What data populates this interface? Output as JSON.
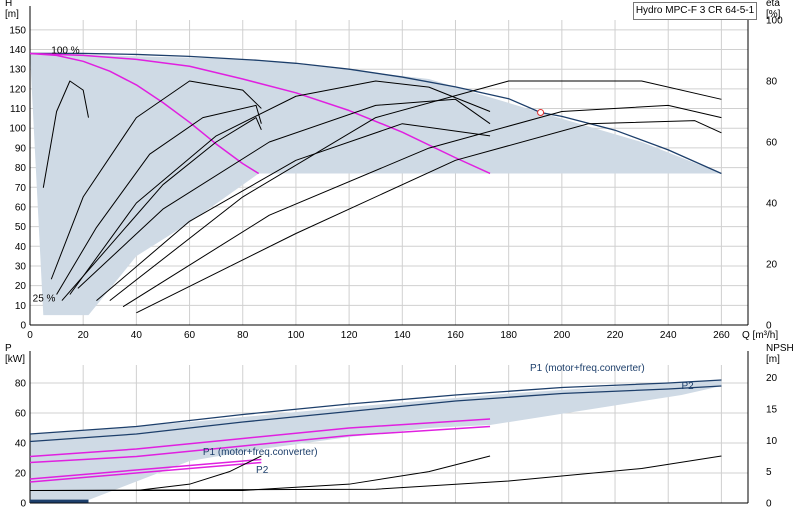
{
  "title": "Hydro MPC-F 3 CR 64-5-1",
  "colors": {
    "envelope": "#cfdae5",
    "max_curve": "#1d3f6b",
    "speed_curve": "#e020e0",
    "eff_curve": "#000000",
    "grid": "#d0d0d0"
  },
  "chart_data": [
    {
      "type": "line",
      "name": "head-efficiency",
      "xlabel": "Q [m³/h]",
      "ylabel": "H",
      "ylabel_unit": "[m]",
      "y2label": "eta",
      "y2label_unit": "[%]",
      "xlim": [
        0,
        270
      ],
      "ylim": [
        0,
        155
      ],
      "y2lim": [
        0,
        100
      ],
      "xticks": [
        0,
        20,
        40,
        60,
        80,
        100,
        120,
        140,
        160,
        180,
        200,
        220,
        240,
        260
      ],
      "yticks": [
        0,
        10,
        20,
        30,
        40,
        50,
        60,
        70,
        80,
        90,
        100,
        110,
        120,
        130,
        140,
        150
      ],
      "y2ticks": [
        0,
        20,
        40,
        60,
        80,
        100
      ],
      "grid": true,
      "annotations": [
        "100 %",
        "25 %"
      ],
      "duty_point": {
        "x": 192,
        "y": 108
      },
      "envelope": [
        [
          0,
          138
        ],
        [
          85,
          135
        ],
        [
          150,
          125
        ],
        [
          192,
          108
        ],
        [
          230,
          93
        ],
        [
          260,
          77
        ],
        [
          260,
          77
        ],
        [
          86,
          77
        ],
        [
          60,
          52
        ],
        [
          40,
          35
        ],
        [
          22,
          5
        ],
        [
          5,
          5
        ],
        [
          0,
          138
        ]
      ],
      "series": [
        {
          "role": "max",
          "x": [
            0,
            20,
            40,
            60,
            86,
            100,
            120,
            140,
            160,
            180,
            192,
            200,
            220,
            240,
            260
          ],
          "y": [
            138,
            138,
            137.5,
            136.5,
            134.5,
            133,
            130,
            126,
            121,
            115,
            108,
            106,
            99,
            89,
            77
          ]
        },
        {
          "role": "speed",
          "x": [
            0,
            20,
            40,
            60,
            80,
            100,
            120,
            140,
            160,
            173
          ],
          "y": [
            138,
            137,
            135,
            131.5,
            125,
            118,
            109,
            98,
            85,
            77
          ]
        },
        {
          "role": "speed",
          "x": [
            0,
            10,
            20,
            30,
            40,
            50,
            60,
            70,
            80,
            86
          ],
          "y": [
            138,
            137,
            134,
            129,
            122,
            113,
            103,
            92,
            82,
            77
          ]
        },
        {
          "role": "eff",
          "x": [
            8,
            20,
            40,
            60,
            80,
            87
          ],
          "y2": [
            15,
            42,
            68,
            80,
            77,
            71
          ]
        },
        {
          "role": "eff",
          "x": [
            10,
            25,
            45,
            65,
            85,
            87
          ],
          "y2": [
            10,
            32,
            56,
            68,
            72,
            66
          ]
        },
        {
          "role": "eff",
          "x": [
            12,
            30,
            50,
            70,
            85,
            87
          ],
          "y2": [
            8,
            26,
            46,
            60,
            68,
            64
          ]
        },
        {
          "role": "eff",
          "x": [
            15,
            40,
            70,
            100,
            130,
            150,
            173
          ],
          "y2": [
            10,
            40,
            62,
            75,
            80,
            78,
            70
          ]
        },
        {
          "role": "eff",
          "x": [
            18,
            50,
            90,
            130,
            160,
            173
          ],
          "y2": [
            12,
            38,
            60,
            72,
            74,
            66
          ]
        },
        {
          "role": "eff",
          "x": [
            25,
            60,
            100,
            140,
            173
          ],
          "y2": [
            8,
            34,
            54,
            66,
            62
          ]
        },
        {
          "role": "eff",
          "x": [
            30,
            80,
            130,
            180,
            230,
            260
          ],
          "y2": [
            8,
            42,
            68,
            80,
            80,
            74
          ]
        },
        {
          "role": "eff",
          "x": [
            35,
            90,
            150,
            200,
            240,
            260
          ],
          "y2": [
            6,
            36,
            58,
            70,
            72,
            68
          ]
        },
        {
          "role": "eff",
          "x": [
            40,
            100,
            160,
            210,
            250,
            260
          ],
          "y2": [
            4,
            30,
            54,
            66,
            67,
            63
          ]
        },
        {
          "role": "eff",
          "x": [
            5,
            10,
            15,
            20,
            22
          ],
          "y2": [
            45,
            70,
            80,
            77,
            68
          ]
        }
      ]
    },
    {
      "type": "line",
      "name": "power-npsh",
      "xlabel": "",
      "ylabel": "P",
      "ylabel_unit": "[kW]",
      "y2label": "NPSH",
      "y2label_unit": "[m]",
      "xlim": [
        0,
        270
      ],
      "ylim": [
        0,
        92
      ],
      "y2lim": [
        0,
        22
      ],
      "yticks": [
        0,
        20,
        40,
        60,
        80
      ],
      "y2ticks": [
        0,
        5,
        10,
        15,
        20
      ],
      "grid": true,
      "labels": [
        {
          "text": "P1 (motor+freq.converter)",
          "x": 188,
          "y": 88
        },
        {
          "text": "P2",
          "x": 245,
          "y": 76
        },
        {
          "text": "P1 (motor+freq.converter)",
          "x": 65,
          "y": 32
        },
        {
          "text": "P2",
          "x": 85,
          "y": 20
        }
      ],
      "envelope": [
        [
          0,
          46
        ],
        [
          60,
          54
        ],
        [
          120,
          64
        ],
        [
          180,
          73
        ],
        [
          230,
          79
        ],
        [
          260,
          82
        ],
        [
          260,
          78
        ],
        [
          245,
          72
        ],
        [
          173,
          52
        ],
        [
          150,
          50
        ],
        [
          120,
          44
        ],
        [
          87,
          36
        ],
        [
          60,
          28
        ],
        [
          22,
          2
        ],
        [
          0,
          2
        ]
      ],
      "series": [
        {
          "role": "max",
          "x": [
            0,
            40,
            80,
            120,
            160,
            200,
            240,
            260
          ],
          "y": [
            46,
            51,
            59,
            66,
            72,
            77,
            80,
            82
          ]
        },
        {
          "role": "max",
          "x": [
            0,
            40,
            80,
            120,
            160,
            200,
            240,
            260
          ],
          "y": [
            41,
            46,
            54,
            61,
            68,
            73,
            76,
            78
          ]
        },
        {
          "role": "speed",
          "x": [
            0,
            40,
            80,
            120,
            173
          ],
          "y": [
            31,
            36,
            43,
            50,
            56
          ]
        },
        {
          "role": "speed",
          "x": [
            0,
            40,
            80,
            120,
            173
          ],
          "y": [
            27,
            31,
            38,
            45,
            51
          ]
        },
        {
          "role": "speed",
          "x": [
            0,
            20,
            40,
            60,
            87
          ],
          "y": [
            16,
            19,
            22,
            25,
            29
          ]
        },
        {
          "role": "speed",
          "x": [
            0,
            20,
            40,
            60,
            87
          ],
          "y": [
            14,
            17,
            20,
            23,
            27
          ]
        },
        {
          "role": "npsh",
          "x": [
            0,
            40,
            60,
            75,
            87
          ],
          "y2": [
            2,
            2,
            3,
            5,
            7.5
          ]
        },
        {
          "role": "npsh",
          "x": [
            0,
            80,
            120,
            150,
            173
          ],
          "y2": [
            2,
            2,
            3,
            5,
            7.5
          ]
        },
        {
          "role": "npsh",
          "x": [
            0,
            130,
            180,
            230,
            260
          ],
          "y2": [
            2,
            2.2,
            3.5,
            5.5,
            7.5
          ]
        },
        {
          "role": "npsh_small",
          "x": [
            0,
            22
          ],
          "y2": [
            0.3,
            0.3
          ]
        }
      ]
    }
  ]
}
